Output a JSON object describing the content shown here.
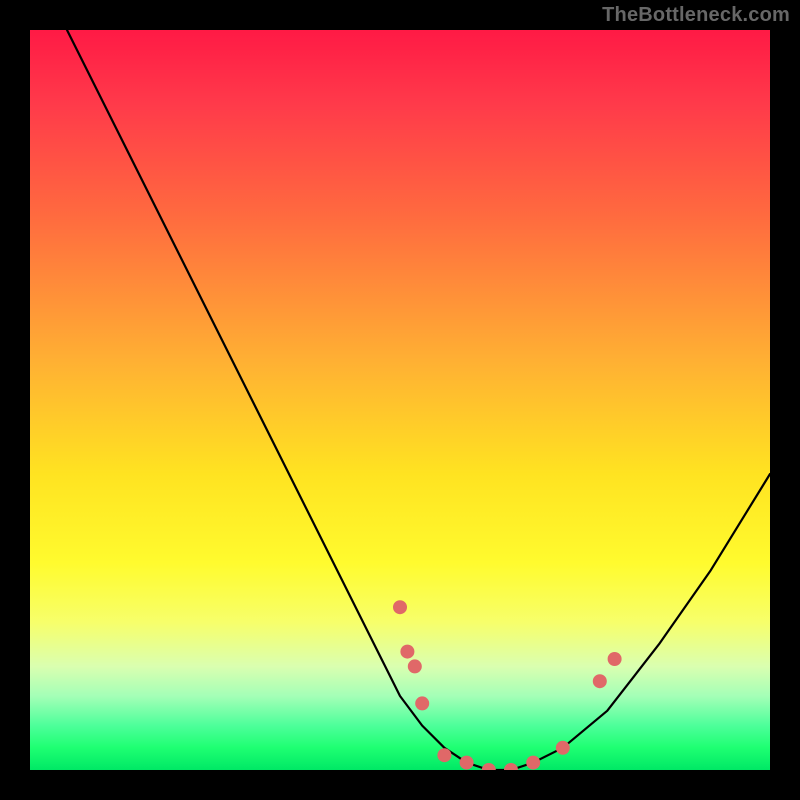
{
  "watermark": "TheBottleneck.com",
  "colors": {
    "frame": "#000000",
    "curve": "#000000",
    "marker": "#e06868",
    "gradient_stops": [
      "#ff1a45",
      "#ff3a4a",
      "#ff6a3f",
      "#ffb133",
      "#ffe321",
      "#fffb2e",
      "#f7ff6a",
      "#daffb0",
      "#a4ffb7",
      "#4dff9a",
      "#1eff72",
      "#00e865"
    ]
  },
  "chart_data": {
    "type": "line",
    "title": "",
    "xlabel": "",
    "ylabel": "",
    "xlim": [
      0,
      100
    ],
    "ylim": [
      0,
      100
    ],
    "grid": false,
    "legend": false,
    "note": "V-shaped bottleneck curve on red→green gradient; y≈100 means heavy bottleneck (red), y≈0 means balanced (green). Markers cluster near the valley.",
    "series": [
      {
        "name": "bottleneck-curve",
        "x": [
          5,
          10,
          15,
          20,
          25,
          30,
          35,
          40,
          45,
          48,
          50,
          53,
          56,
          59,
          62,
          65,
          68,
          72,
          78,
          85,
          92,
          100
        ],
        "y": [
          100,
          90,
          80,
          70,
          60,
          50,
          40,
          30,
          20,
          14,
          10,
          6,
          3,
          1,
          0,
          0,
          1,
          3,
          8,
          17,
          27,
          40
        ]
      }
    ],
    "markers": [
      {
        "x": 50,
        "y": 22
      },
      {
        "x": 51,
        "y": 16
      },
      {
        "x": 52,
        "y": 14
      },
      {
        "x": 53,
        "y": 9
      },
      {
        "x": 56,
        "y": 2
      },
      {
        "x": 59,
        "y": 1
      },
      {
        "x": 62,
        "y": 0
      },
      {
        "x": 65,
        "y": 0
      },
      {
        "x": 68,
        "y": 1
      },
      {
        "x": 72,
        "y": 3
      },
      {
        "x": 77,
        "y": 12
      },
      {
        "x": 79,
        "y": 15
      }
    ]
  }
}
